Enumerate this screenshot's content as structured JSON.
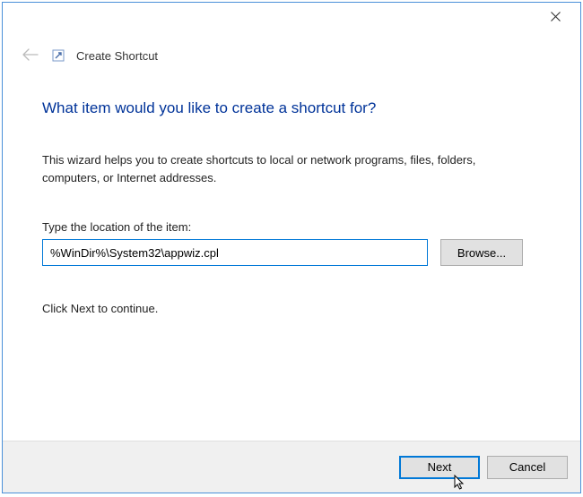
{
  "header": {
    "title": "Create Shortcut"
  },
  "content": {
    "heading": "What item would you like to create a shortcut for?",
    "description": "This wizard helps you to create shortcuts to local or network programs, files, folders, computers, or Internet addresses.",
    "location_label": "Type the location of the item:",
    "location_value": "%WinDir%\\System32\\appwiz.cpl",
    "browse_label": "Browse...",
    "continue_text": "Click Next to continue."
  },
  "footer": {
    "next_label": "Next",
    "cancel_label": "Cancel"
  }
}
